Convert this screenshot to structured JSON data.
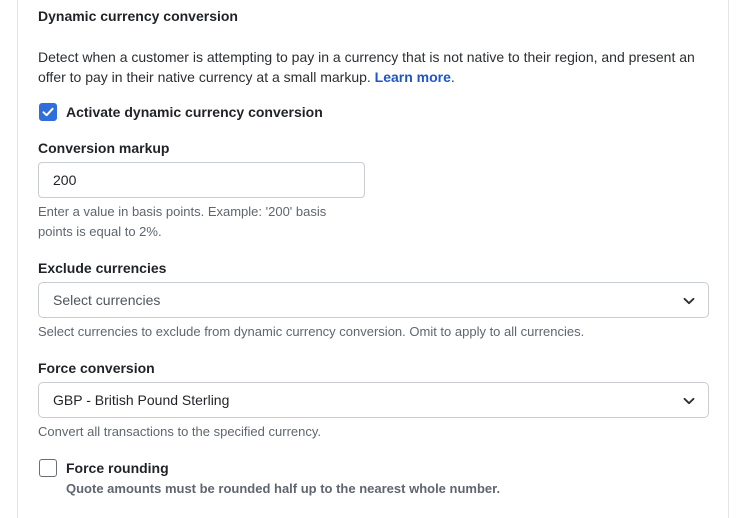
{
  "section": {
    "title": "Dynamic currency conversion",
    "description": "Detect when a customer is attempting to pay in a currency that is not native to their region, and present an offer to pay in their native currency at a small markup. ",
    "learn_more": "Learn more",
    "learn_more_suffix": "."
  },
  "activate": {
    "label": "Activate dynamic currency conversion",
    "checked": true
  },
  "markup": {
    "label": "Conversion markup",
    "value": "200",
    "help": "Enter a value in basis points. Example: '200' basis points is equal to 2%."
  },
  "exclude": {
    "label": "Exclude currencies",
    "placeholder": "Select currencies",
    "help": "Select currencies to exclude from dynamic currency conversion. Omit to apply to all currencies."
  },
  "force_conversion": {
    "label": "Force conversion",
    "value": "GBP - British Pound Sterling",
    "help": "Convert all transactions to the specified currency."
  },
  "force_rounding": {
    "label": "Force rounding",
    "checked": false,
    "help": "Quote amounts must be rounded half up to the nearest whole number."
  },
  "icons": {
    "checkmark": "check-icon",
    "dropdown": "chevron-down-icon"
  },
  "colors": {
    "accent": "#2f6fdd",
    "link": "#1f56c6",
    "help_text": "#5f6670",
    "border": "#c9cdd2"
  }
}
